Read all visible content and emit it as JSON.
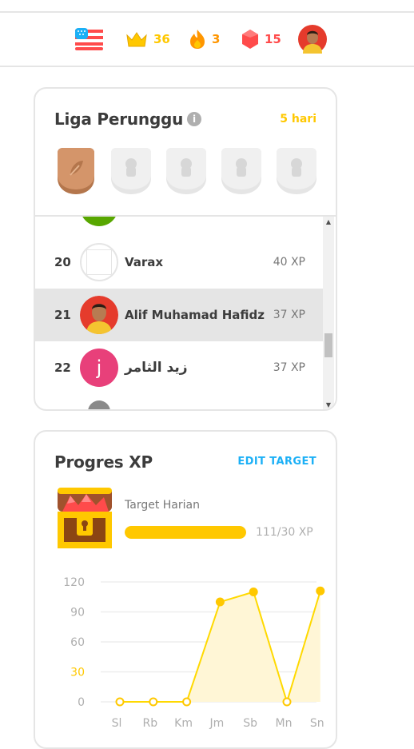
{
  "header": {
    "flag_icon": "us-flag-icon",
    "crowns": "36",
    "streak": "3",
    "gems": "15"
  },
  "league": {
    "title": "Liga Perunggu",
    "days_left": "5 hari",
    "rows": [
      {
        "rank": "20",
        "name": "Varax",
        "xp": "40 XP"
      },
      {
        "rank": "21",
        "name": "Alif Muhamad Hafidz",
        "xp": "37 XP"
      },
      {
        "rank": "22",
        "name": "زيد الثامر",
        "xp": "37 XP",
        "avatar_letter": "j"
      }
    ]
  },
  "progress": {
    "title": "Progres XP",
    "edit_label": "EDIT TARGET",
    "target_label": "Target Harian",
    "target_value": "111/30 XP",
    "target_fill_fraction": 1.0
  },
  "chart_data": {
    "type": "area",
    "categories": [
      "Sl",
      "Rb",
      "Km",
      "Jm",
      "Sb",
      "Mn",
      "Sn"
    ],
    "values": [
      0,
      0,
      0,
      100,
      110,
      0,
      111
    ],
    "yticks": [
      0,
      30,
      60,
      90,
      120
    ],
    "ylim": [
      0,
      120
    ],
    "highlight_tick": 30,
    "grid": true,
    "colors": {
      "line": "#ffd900",
      "fill": "#fff6d6",
      "highlight": "#ffc800",
      "ticks": "#afafaf"
    }
  }
}
